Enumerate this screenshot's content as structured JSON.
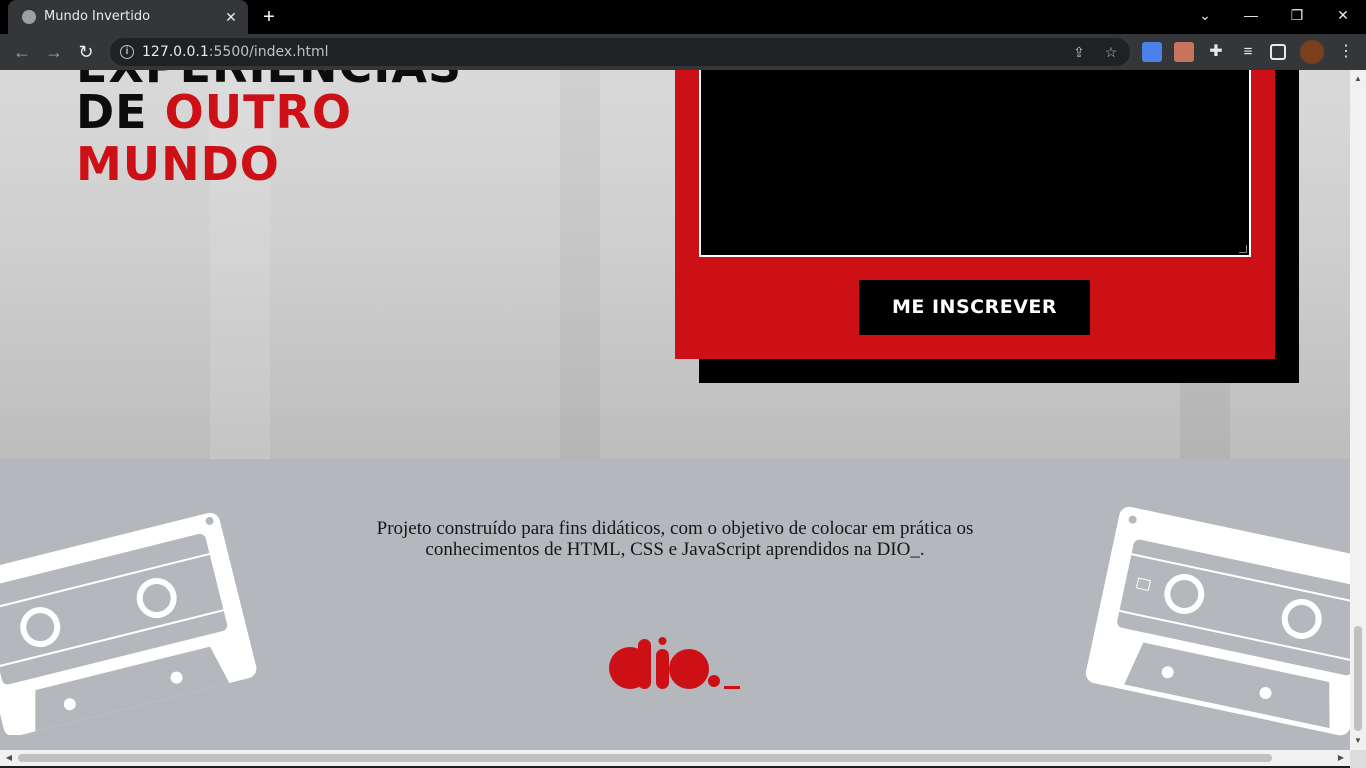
{
  "browser": {
    "tab_title": "Mundo Invertido",
    "tab_close": "✕",
    "new_tab": "+",
    "url_host": "127.0.0.1",
    "url_rest": ":5500/index.html",
    "icons": [
      "back-arrow-icon",
      "forward-arrow-icon",
      "reload-icon",
      "site-info-icon",
      "share-icon",
      "bookmark-star-icon",
      "google-translate-icon",
      "cast-icon",
      "extensions-puzzle-icon",
      "reading-list-icon",
      "side-panel-icon",
      "profile-avatar-icon"
    ]
  },
  "hero": {
    "headline_cut": "EXPERIÊNCIAS",
    "headline_de": "DE",
    "headline_outro": "OUTRO",
    "headline_mundo": "MUNDO"
  },
  "form": {
    "submit_label": "ME INSCREVER"
  },
  "footer": {
    "text": "Projeto construído para fins didáticos, com o objetivo de colocar em prática os conhecimentos de HTML, CSS e JavaScript aprendidos na DIO_."
  },
  "colors": {
    "brand_red": "#cc1016",
    "black": "#000000",
    "footer_bg": "#b4b8bd",
    "chrome_dark": "#35363a"
  }
}
